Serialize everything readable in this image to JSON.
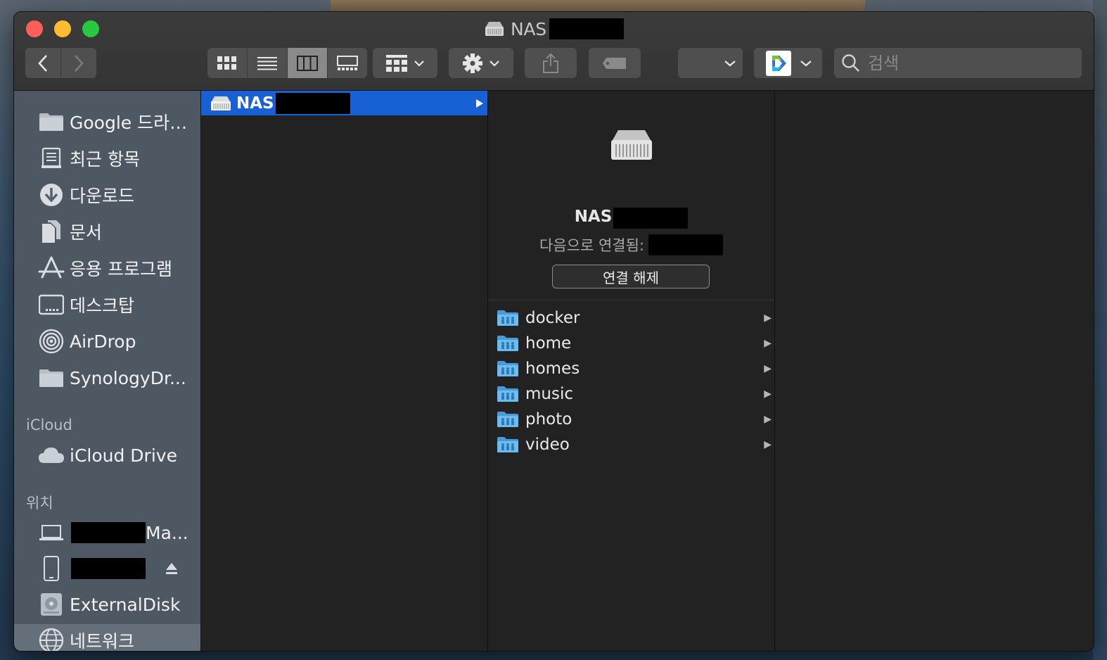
{
  "window": {
    "title": "NAS",
    "title_redacted": true
  },
  "toolbar": {
    "back_icon": "chevron-left-icon",
    "forward_icon": "chevron-right-icon",
    "view_modes": [
      "icon-view",
      "list-view",
      "column-view",
      "gallery-view"
    ],
    "active_view": "column-view",
    "group_by_icon": "grid-group-icon",
    "action_icon": "gear-icon",
    "share_icon": "share-icon",
    "tag_icon": "tag-icon",
    "search_placeholder": "검색"
  },
  "sidebar": {
    "favorites": [
      {
        "label": "Google 드라…",
        "icon": "folder-icon"
      },
      {
        "label": "최근 항목",
        "icon": "recents-icon"
      },
      {
        "label": "다운로드",
        "icon": "download-icon"
      },
      {
        "label": "문서",
        "icon": "document-icon"
      },
      {
        "label": "응용 프로그램",
        "icon": "applications-icon"
      },
      {
        "label": "데스크탑",
        "icon": "desktop-icon"
      },
      {
        "label": "AirDrop",
        "icon": "airdrop-icon"
      },
      {
        "label": "SynologyDr...",
        "icon": "folder-icon"
      }
    ],
    "icloud_header": "iCloud",
    "icloud_items": [
      {
        "label": "iCloud Drive",
        "icon": "cloud-icon"
      }
    ],
    "locations_header": "위치",
    "locations": [
      {
        "label": "Ma...",
        "icon": "laptop-icon",
        "redacted": true
      },
      {
        "label": "",
        "icon": "phone-icon",
        "redacted": true,
        "eject": true
      },
      {
        "label": "ExternalDisk",
        "icon": "disk-icon"
      },
      {
        "label": "네트워크",
        "icon": "network-icon",
        "selected": true
      }
    ]
  },
  "column1": {
    "items": [
      {
        "label": "NAS",
        "redacted": true,
        "selected": true
      }
    ]
  },
  "preview": {
    "name": "NAS",
    "connected_as_label": "다음으로 연결됨:",
    "disconnect_label": "연결 해제"
  },
  "column2": {
    "folders": [
      "docker",
      "home",
      "homes",
      "music",
      "photo",
      "video"
    ]
  },
  "colors": {
    "selection": "#1860d6",
    "folder": "#5aaee6",
    "close": "#fe5f57",
    "minimize": "#febc2e",
    "maximize": "#28c840"
  }
}
